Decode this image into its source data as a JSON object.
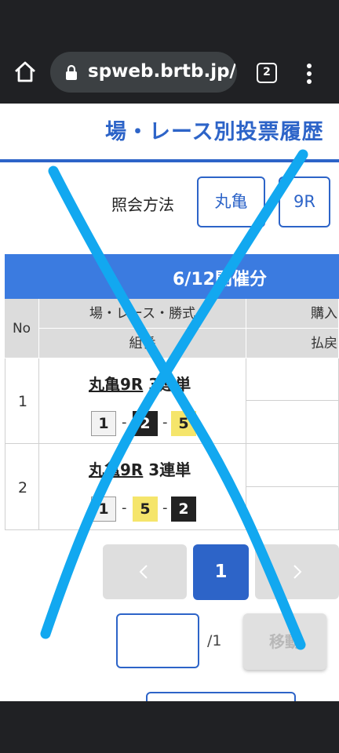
{
  "browser": {
    "url": "spweb.brtb.jp/",
    "tab_count": "2"
  },
  "page": {
    "title": "場・レース別投票履歴",
    "query_label": "照会方法",
    "venue_button": "丸亀",
    "race_button": "9R",
    "date_header": "6/12開催分"
  },
  "table": {
    "headers": {
      "no": "No",
      "race_info": "場・レース・勝式",
      "combination": "組番",
      "purchase": "購入",
      "payout": "払戻"
    },
    "rows": [
      {
        "no": "1",
        "race_link": "丸亀9R",
        "bet_type": "3連単",
        "combo": [
          {
            "num": "1",
            "color": "white"
          },
          {
            "num": "2",
            "color": "black"
          },
          {
            "num": "5",
            "color": "yellow"
          }
        ]
      },
      {
        "no": "2",
        "race_link": "丸亀9R",
        "bet_type": "3連単",
        "combo": [
          {
            "num": "1",
            "color": "white"
          },
          {
            "num": "5",
            "color": "yellow"
          },
          {
            "num": "2",
            "color": "black"
          }
        ]
      }
    ],
    "separator": "-"
  },
  "pagination": {
    "current_page": "1",
    "input_value": "",
    "total": "/1",
    "move_label": "移動"
  },
  "colors": {
    "accent": "#2d64c8",
    "date_band": "#3b7be0",
    "overlay_cross": "#12a8f0"
  },
  "overlay": {
    "icon": "cross-mark-icon"
  }
}
